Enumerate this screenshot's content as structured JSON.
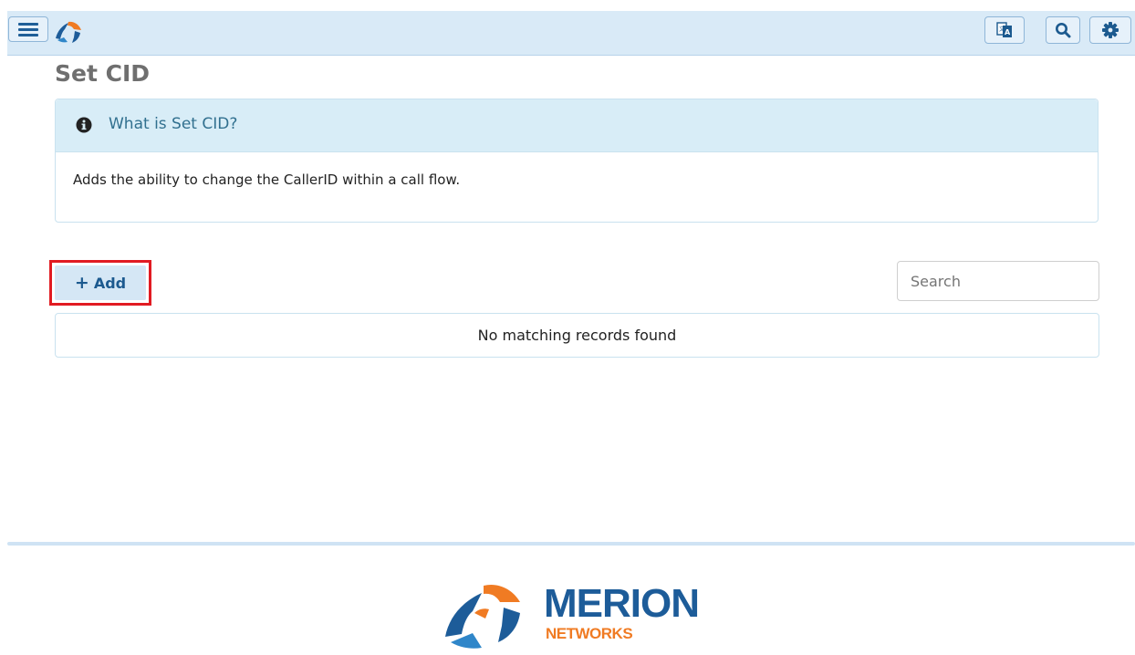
{
  "header": {
    "menu_icon": "hamburger-menu-icon",
    "logo_icon": "merion-pinwheel-logo",
    "tools": [
      {
        "icon": "translate-icon"
      },
      {
        "icon": "search-icon"
      },
      {
        "icon": "gear-icon"
      }
    ]
  },
  "page": {
    "title": "Set CID"
  },
  "info_panel": {
    "icon": "info-circle-icon",
    "heading": "What is Set CID?",
    "body": "Adds the ability to change the CallerID within a call flow."
  },
  "toolbar": {
    "add_icon": "plus-icon",
    "add_label": "Add",
    "search_placeholder": "Search",
    "search_value": ""
  },
  "table": {
    "empty_message": "No matching records found"
  },
  "footer": {
    "brand_name": "MERION",
    "brand_sub": "NETWORKS"
  },
  "colors": {
    "topbar": "#d9eaf7",
    "info_heading": "#31708f",
    "brand_blue": "#1d5c99",
    "brand_orange": "#f07b23",
    "highlight_red": "#e11b22"
  }
}
